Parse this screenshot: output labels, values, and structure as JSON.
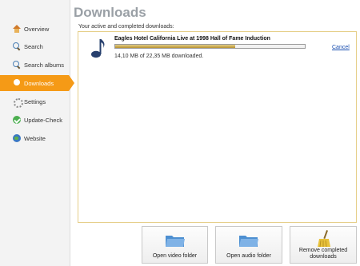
{
  "sidebar": {
    "items": [
      {
        "label": "Overview",
        "icon": "home-icon"
      },
      {
        "label": "Search",
        "icon": "search-icon"
      },
      {
        "label": "Search albums",
        "icon": "search-icon"
      },
      {
        "label": "Downloads",
        "icon": "download-icon",
        "active": true
      },
      {
        "label": "Settings",
        "icon": "gear-icon"
      },
      {
        "label": "Update-Check",
        "icon": "check-icon"
      },
      {
        "label": "Website",
        "icon": "globe-icon"
      }
    ]
  },
  "main": {
    "title": "Downloads",
    "subtitle": "Your active and completed downloads:",
    "downloads": [
      {
        "title": "Eagles Hotel California Live at 1998 Hall of Fame Induction",
        "status": "14,10 MB of 22,35 MB downloaded.",
        "progress": 0.631,
        "cancel_label": "Cancel"
      }
    ]
  },
  "buttons": {
    "open_video": "Open video folder",
    "open_audio": "Open audio folder",
    "remove_completed": "Remove completed downloads"
  },
  "colors": {
    "accent": "#f59a16",
    "panel_border": "#e6cf8a",
    "link": "#1a4fb0"
  }
}
